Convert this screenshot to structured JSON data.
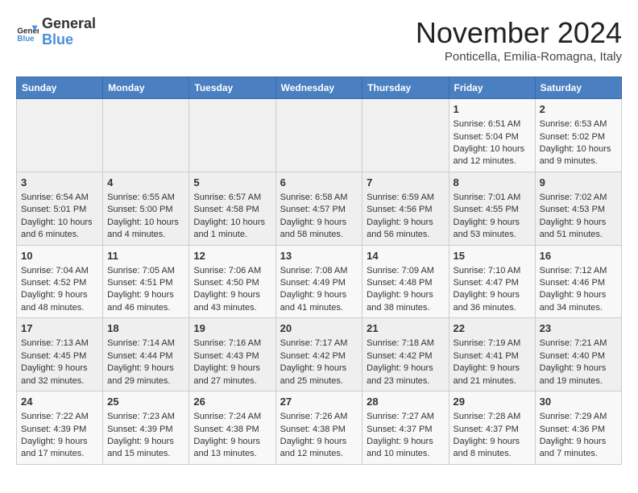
{
  "header": {
    "logo_general": "General",
    "logo_blue": "Blue",
    "month_title": "November 2024",
    "subtitle": "Ponticella, Emilia-Romagna, Italy"
  },
  "days_of_week": [
    "Sunday",
    "Monday",
    "Tuesday",
    "Wednesday",
    "Thursday",
    "Friday",
    "Saturday"
  ],
  "weeks": [
    [
      {
        "day": "",
        "info": ""
      },
      {
        "day": "",
        "info": ""
      },
      {
        "day": "",
        "info": ""
      },
      {
        "day": "",
        "info": ""
      },
      {
        "day": "",
        "info": ""
      },
      {
        "day": "1",
        "info": "Sunrise: 6:51 AM\nSunset: 5:04 PM\nDaylight: 10 hours and 12 minutes."
      },
      {
        "day": "2",
        "info": "Sunrise: 6:53 AM\nSunset: 5:02 PM\nDaylight: 10 hours and 9 minutes."
      }
    ],
    [
      {
        "day": "3",
        "info": "Sunrise: 6:54 AM\nSunset: 5:01 PM\nDaylight: 10 hours and 6 minutes."
      },
      {
        "day": "4",
        "info": "Sunrise: 6:55 AM\nSunset: 5:00 PM\nDaylight: 10 hours and 4 minutes."
      },
      {
        "day": "5",
        "info": "Sunrise: 6:57 AM\nSunset: 4:58 PM\nDaylight: 10 hours and 1 minute."
      },
      {
        "day": "6",
        "info": "Sunrise: 6:58 AM\nSunset: 4:57 PM\nDaylight: 9 hours and 58 minutes."
      },
      {
        "day": "7",
        "info": "Sunrise: 6:59 AM\nSunset: 4:56 PM\nDaylight: 9 hours and 56 minutes."
      },
      {
        "day": "8",
        "info": "Sunrise: 7:01 AM\nSunset: 4:55 PM\nDaylight: 9 hours and 53 minutes."
      },
      {
        "day": "9",
        "info": "Sunrise: 7:02 AM\nSunset: 4:53 PM\nDaylight: 9 hours and 51 minutes."
      }
    ],
    [
      {
        "day": "10",
        "info": "Sunrise: 7:04 AM\nSunset: 4:52 PM\nDaylight: 9 hours and 48 minutes."
      },
      {
        "day": "11",
        "info": "Sunrise: 7:05 AM\nSunset: 4:51 PM\nDaylight: 9 hours and 46 minutes."
      },
      {
        "day": "12",
        "info": "Sunrise: 7:06 AM\nSunset: 4:50 PM\nDaylight: 9 hours and 43 minutes."
      },
      {
        "day": "13",
        "info": "Sunrise: 7:08 AM\nSunset: 4:49 PM\nDaylight: 9 hours and 41 minutes."
      },
      {
        "day": "14",
        "info": "Sunrise: 7:09 AM\nSunset: 4:48 PM\nDaylight: 9 hours and 38 minutes."
      },
      {
        "day": "15",
        "info": "Sunrise: 7:10 AM\nSunset: 4:47 PM\nDaylight: 9 hours and 36 minutes."
      },
      {
        "day": "16",
        "info": "Sunrise: 7:12 AM\nSunset: 4:46 PM\nDaylight: 9 hours and 34 minutes."
      }
    ],
    [
      {
        "day": "17",
        "info": "Sunrise: 7:13 AM\nSunset: 4:45 PM\nDaylight: 9 hours and 32 minutes."
      },
      {
        "day": "18",
        "info": "Sunrise: 7:14 AM\nSunset: 4:44 PM\nDaylight: 9 hours and 29 minutes."
      },
      {
        "day": "19",
        "info": "Sunrise: 7:16 AM\nSunset: 4:43 PM\nDaylight: 9 hours and 27 minutes."
      },
      {
        "day": "20",
        "info": "Sunrise: 7:17 AM\nSunset: 4:42 PM\nDaylight: 9 hours and 25 minutes."
      },
      {
        "day": "21",
        "info": "Sunrise: 7:18 AM\nSunset: 4:42 PM\nDaylight: 9 hours and 23 minutes."
      },
      {
        "day": "22",
        "info": "Sunrise: 7:19 AM\nSunset: 4:41 PM\nDaylight: 9 hours and 21 minutes."
      },
      {
        "day": "23",
        "info": "Sunrise: 7:21 AM\nSunset: 4:40 PM\nDaylight: 9 hours and 19 minutes."
      }
    ],
    [
      {
        "day": "24",
        "info": "Sunrise: 7:22 AM\nSunset: 4:39 PM\nDaylight: 9 hours and 17 minutes."
      },
      {
        "day": "25",
        "info": "Sunrise: 7:23 AM\nSunset: 4:39 PM\nDaylight: 9 hours and 15 minutes."
      },
      {
        "day": "26",
        "info": "Sunrise: 7:24 AM\nSunset: 4:38 PM\nDaylight: 9 hours and 13 minutes."
      },
      {
        "day": "27",
        "info": "Sunrise: 7:26 AM\nSunset: 4:38 PM\nDaylight: 9 hours and 12 minutes."
      },
      {
        "day": "28",
        "info": "Sunrise: 7:27 AM\nSunset: 4:37 PM\nDaylight: 9 hours and 10 minutes."
      },
      {
        "day": "29",
        "info": "Sunrise: 7:28 AM\nSunset: 4:37 PM\nDaylight: 9 hours and 8 minutes."
      },
      {
        "day": "30",
        "info": "Sunrise: 7:29 AM\nSunset: 4:36 PM\nDaylight: 9 hours and 7 minutes."
      }
    ]
  ]
}
